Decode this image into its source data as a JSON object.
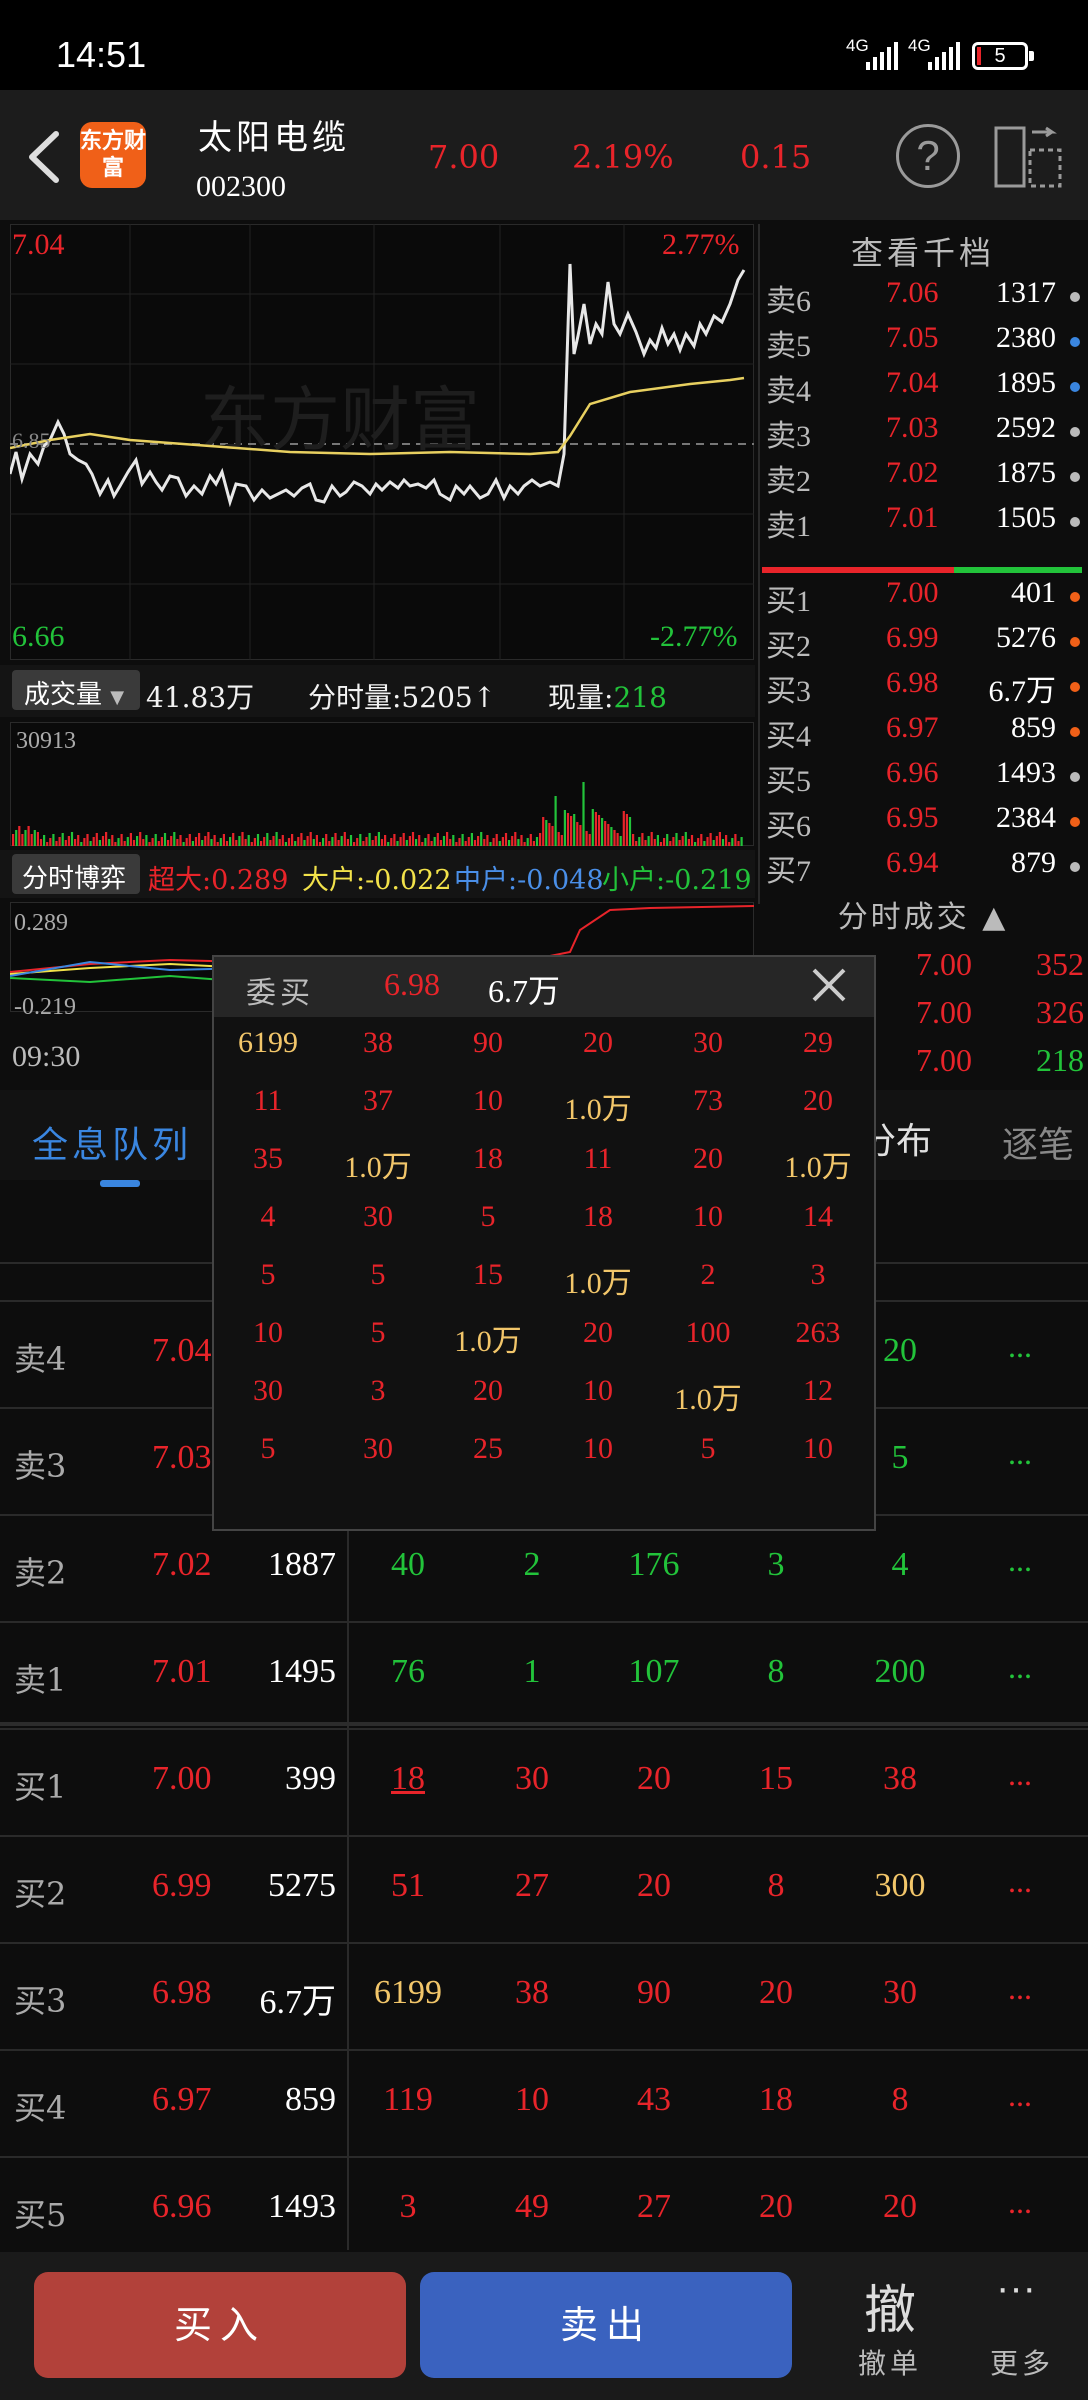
{
  "status": {
    "time": "14:51",
    "net1": "4G",
    "net2": "4G",
    "battery": "5"
  },
  "header": {
    "logo_text": "东方财富",
    "name": "太阳电缆",
    "code": "002300",
    "price": "7.00",
    "change_pct": "2.19%",
    "change": "0.15"
  },
  "chart": {
    "high": "7.04",
    "high_pct": "2.77%",
    "low": "6.66",
    "low_pct": "-2.77%",
    "ref": "6.85",
    "watermark": "东方财富",
    "time_start": "09:30"
  },
  "volume_bar": {
    "selector": "成交量",
    "total": "41.83万",
    "tick_label": "分时量:5205",
    "now_label": "现量:",
    "now_value": "218",
    "max": "30913"
  },
  "game_bar": {
    "selector": "分时博弈",
    "super": "超大:0.289",
    "big": "大户:-0.022",
    "mid": "中户:-0.048",
    "small": "小户:-0.219",
    "top": "0.289",
    "bottom": "-0.219"
  },
  "book": {
    "title": "查看千档",
    "asks": [
      {
        "label": "卖6",
        "price": "7.06",
        "vol": "1317",
        "dot": "#bbbbbb"
      },
      {
        "label": "卖5",
        "price": "7.05",
        "vol": "2380",
        "dot": "#3a86e0"
      },
      {
        "label": "卖4",
        "price": "7.04",
        "vol": "1895",
        "dot": "#3a86e0"
      },
      {
        "label": "卖3",
        "price": "7.03",
        "vol": "2592",
        "dot": "#bbbbbb"
      },
      {
        "label": "卖2",
        "price": "7.02",
        "vol": "1875",
        "dot": "#bbbbbb"
      },
      {
        "label": "卖1",
        "price": "7.01",
        "vol": "1505",
        "dot": "#bbbbbb"
      }
    ],
    "bids": [
      {
        "label": "买1",
        "price": "7.00",
        "vol": "401",
        "dot": "#f06018"
      },
      {
        "label": "买2",
        "price": "6.99",
        "vol": "5276",
        "dot": "#f06018"
      },
      {
        "label": "买3",
        "price": "6.98",
        "vol": "6.7万",
        "dot": "#f06018"
      },
      {
        "label": "买4",
        "price": "6.97",
        "vol": "859",
        "dot": "#f06018"
      },
      {
        "label": "买5",
        "price": "6.96",
        "vol": "1493",
        "dot": "#bbbbbb"
      },
      {
        "label": "买6",
        "price": "6.95",
        "vol": "2384",
        "dot": "#f06018"
      },
      {
        "label": "买7",
        "price": "6.94",
        "vol": "879",
        "dot": "#bbbbbb"
      }
    ]
  },
  "trades": {
    "title": "分时成交",
    "rows": [
      {
        "price": "7.00",
        "vol": "352",
        "color": "red"
      },
      {
        "price": "7.00",
        "vol": "326",
        "color": "red"
      },
      {
        "price": "7.00",
        "vol": "218",
        "color": "green"
      }
    ]
  },
  "tabs": {
    "queue": "全息队列",
    "dist": "分布",
    "tick": "逐笔"
  },
  "queue": [
    {
      "label": "卖4",
      "price": "7.04",
      "total": "",
      "cells": [
        [
          "",
          ""
        ],
        [
          "",
          ""
        ],
        [
          "",
          ""
        ],
        [
          "",
          ""
        ],
        [
          "20",
          "green"
        ]
      ]
    },
    {
      "label": "卖3",
      "price": "7.03",
      "total": "",
      "cells": [
        [
          "",
          ""
        ],
        [
          "",
          ""
        ],
        [
          "",
          ""
        ],
        [
          "",
          ""
        ],
        [
          "5",
          "green"
        ]
      ]
    },
    {
      "label": "卖2",
      "price": "7.02",
      "total": "1887",
      "cells": [
        [
          "40",
          "green"
        ],
        [
          "2",
          "green"
        ],
        [
          "176",
          "green"
        ],
        [
          "3",
          "green"
        ],
        [
          "4",
          "green"
        ]
      ]
    },
    {
      "label": "卖1",
      "price": "7.01",
      "total": "1495",
      "cells": [
        [
          "76",
          "green"
        ],
        [
          "1",
          "green"
        ],
        [
          "107",
          "green"
        ],
        [
          "8",
          "green"
        ],
        [
          "200",
          "green"
        ]
      ]
    },
    {
      "label": "买1",
      "price": "7.00",
      "total": "399",
      "cells": [
        [
          "18",
          "red"
        ],
        [
          "30",
          "red"
        ],
        [
          "20",
          "red"
        ],
        [
          "15",
          "red"
        ],
        [
          "38",
          "red"
        ]
      ]
    },
    {
      "label": "买2",
      "price": "6.99",
      "total": "5275",
      "cells": [
        [
          "51",
          "red"
        ],
        [
          "27",
          "red"
        ],
        [
          "20",
          "red"
        ],
        [
          "8",
          "red"
        ],
        [
          "300",
          "gold"
        ]
      ]
    },
    {
      "label": "买3",
      "price": "6.98",
      "total": "6.7万",
      "cells": [
        [
          "6199",
          "gold"
        ],
        [
          "38",
          "red"
        ],
        [
          "90",
          "red"
        ],
        [
          "20",
          "red"
        ],
        [
          "30",
          "red"
        ]
      ]
    },
    {
      "label": "买4",
      "price": "6.97",
      "total": "859",
      "cells": [
        [
          "119",
          "red"
        ],
        [
          "10",
          "red"
        ],
        [
          "43",
          "red"
        ],
        [
          "18",
          "red"
        ],
        [
          "8",
          "red"
        ]
      ]
    },
    {
      "label": "买5",
      "price": "6.96",
      "total": "1493",
      "cells": [
        [
          "3",
          "red"
        ],
        [
          "49",
          "red"
        ],
        [
          "27",
          "red"
        ],
        [
          "20",
          "red"
        ],
        [
          "20",
          "red"
        ]
      ]
    }
  ],
  "queue_more": "...",
  "popup": {
    "label": "委买",
    "price": "6.98",
    "vol": "6.7万",
    "grid": [
      [
        [
          "6199",
          "gold"
        ],
        [
          "38",
          "red"
        ],
        [
          "90",
          "red"
        ],
        [
          "20",
          "red"
        ],
        [
          "30",
          "red"
        ],
        [
          "29",
          "red"
        ]
      ],
      [
        [
          "11",
          "red"
        ],
        [
          "37",
          "red"
        ],
        [
          "10",
          "red"
        ],
        [
          "1.0万",
          "gold"
        ],
        [
          "73",
          "red"
        ],
        [
          "20",
          "red"
        ]
      ],
      [
        [
          "35",
          "red"
        ],
        [
          "1.0万",
          "gold"
        ],
        [
          "18",
          "red"
        ],
        [
          "11",
          "red"
        ],
        [
          "20",
          "red"
        ],
        [
          "1.0万",
          "gold"
        ]
      ],
      [
        [
          "4",
          "red"
        ],
        [
          "30",
          "red"
        ],
        [
          "5",
          "red"
        ],
        [
          "18",
          "red"
        ],
        [
          "10",
          "red"
        ],
        [
          "14",
          "red"
        ]
      ],
      [
        [
          "5",
          "red"
        ],
        [
          "5",
          "red"
        ],
        [
          "15",
          "red"
        ],
        [
          "1.0万",
          "gold"
        ],
        [
          "2",
          "red"
        ],
        [
          "3",
          "red"
        ]
      ],
      [
        [
          "10",
          "red"
        ],
        [
          "5",
          "red"
        ],
        [
          "1.0万",
          "gold"
        ],
        [
          "20",
          "red"
        ],
        [
          "100",
          "red"
        ],
        [
          "263",
          "red"
        ]
      ],
      [
        [
          "30",
          "red"
        ],
        [
          "3",
          "red"
        ],
        [
          "20",
          "red"
        ],
        [
          "10",
          "red"
        ],
        [
          "1.0万",
          "gold"
        ],
        [
          "12",
          "red"
        ]
      ],
      [
        [
          "5",
          "red"
        ],
        [
          "30",
          "red"
        ],
        [
          "25",
          "red"
        ],
        [
          "10",
          "red"
        ],
        [
          "5",
          "red"
        ],
        [
          "10",
          "red"
        ]
      ]
    ]
  },
  "bottom": {
    "buy": "买入",
    "sell": "卖出",
    "cancel_glyph": "撤",
    "cancel": "撤单",
    "more_glyph": "···",
    "more": "更多"
  },
  "colors": {
    "red": "#e8242a",
    "green": "#22c33a",
    "gold": "#f2c66a",
    "blue": "#3a86e0",
    "orange": "#f06018"
  }
}
